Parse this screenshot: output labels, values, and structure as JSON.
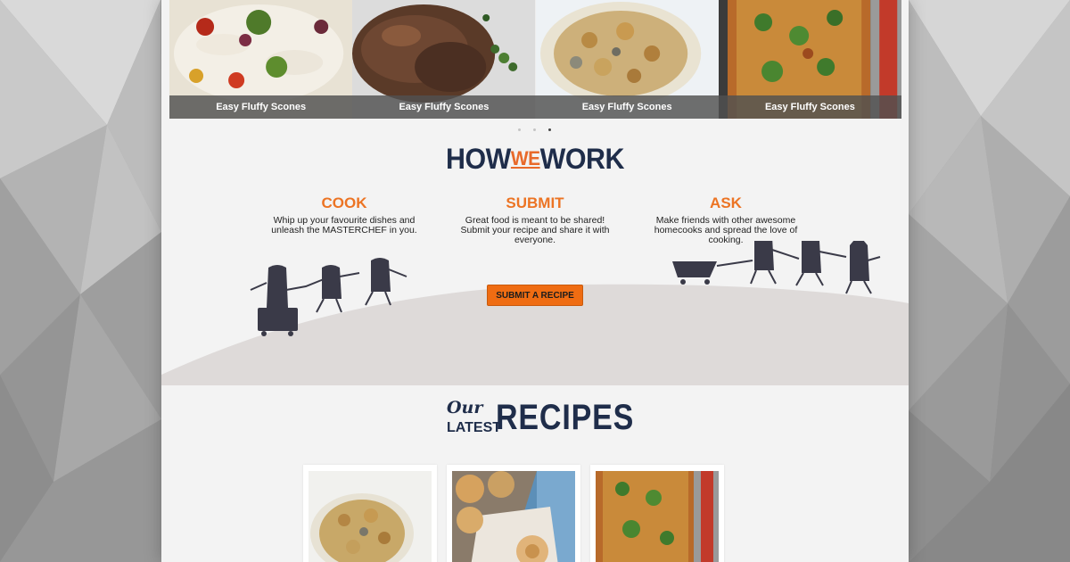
{
  "carousel": {
    "slides": [
      {
        "caption": "Easy Fluffy Scones",
        "image": "squid-salad"
      },
      {
        "caption": "Easy Fluffy Scones",
        "image": "roast-beef"
      },
      {
        "caption": "Easy Fluffy Scones",
        "image": "fusilli-pasta"
      },
      {
        "caption": "Easy Fluffy Scones",
        "image": "baked-casserole"
      }
    ],
    "dot_count": 3,
    "active_dot": 3
  },
  "how_we_work": {
    "title_how": "HOW",
    "title_we": "WE",
    "title_work": "WORK",
    "steps": [
      {
        "title": "COOK",
        "line1": "Whip up your favourite dishes and",
        "line2": "unleash the MASTERCHEF in you.",
        "line3": ""
      },
      {
        "title": "SUBMIT",
        "line1": "Great food is meant to be shared!",
        "line2": "Submit your recipe and share it with",
        "line3": "everyone."
      },
      {
        "title": "ASK",
        "line1": "Make friends with other awesome",
        "line2": "homecooks and spread the love of",
        "line3": "cooking."
      }
    ],
    "button_label": "SUBMIT A RECIPE"
  },
  "latest": {
    "our": "Our",
    "latest": "LATEST",
    "recipes": "RECIPES",
    "cards": [
      {
        "image": "fusilli-pasta"
      },
      {
        "image": "cinnamon-rolls"
      },
      {
        "image": "baked-casserole"
      }
    ]
  },
  "colors": {
    "navy": "#1f2d4a",
    "orange": "#ec7424",
    "button": "#ef6c12",
    "hill": "#dedad9",
    "figure": "#3a3a48"
  }
}
